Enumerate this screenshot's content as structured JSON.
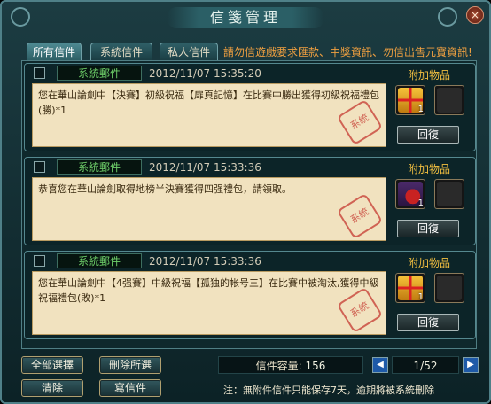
{
  "window": {
    "title": "信箋管理",
    "close_label": "×"
  },
  "tabs": [
    {
      "label": "所有信件",
      "active": true
    },
    {
      "label": "系統信件",
      "active": false
    },
    {
      "label": "私人信件",
      "active": false
    }
  ],
  "notice": "請勿信遊戲要求匯款、中獎資訊、勿信出售元寶資訊!",
  "attachment_label": "附加物品",
  "reply_label": "回復",
  "stamp_label": "系統",
  "mails": [
    {
      "sender": "系統郵件",
      "date": "2012/11/07 15:35:20",
      "body": "您在華山論劍中【決賽】初級祝福【扉頁記憶】在比賽中勝出獲得初級祝福禮包(勝)*1",
      "attachment": {
        "icon": "gift-box-icon",
        "qty": "1"
      }
    },
    {
      "sender": "系統郵件",
      "date": "2012/11/07 15:33:36",
      "body": "恭喜您在華山論劍取得地榜半決賽獲得四强禮包，請領取。",
      "attachment": {
        "icon": "fire-extinguisher-icon",
        "qty": "1"
      }
    },
    {
      "sender": "系統郵件",
      "date": "2012/11/07 15:33:36",
      "body": "您在華山論劍中【4强賽】中級祝福【孤独的帐号三】在比賽中被淘汰,獲得中級祝福禮包(敗)*1",
      "attachment": {
        "icon": "gift-box-icon",
        "qty": "1"
      }
    }
  ],
  "footer": {
    "select_all": "全部選擇",
    "delete_selected": "刪除所選",
    "clear": "清除",
    "compose": "寫信件",
    "capacity_label": "信件容量:",
    "capacity_value": "156",
    "page": "1/52",
    "note": "注：無附件信件只能保存7天，逾期將被系統刪除"
  }
}
